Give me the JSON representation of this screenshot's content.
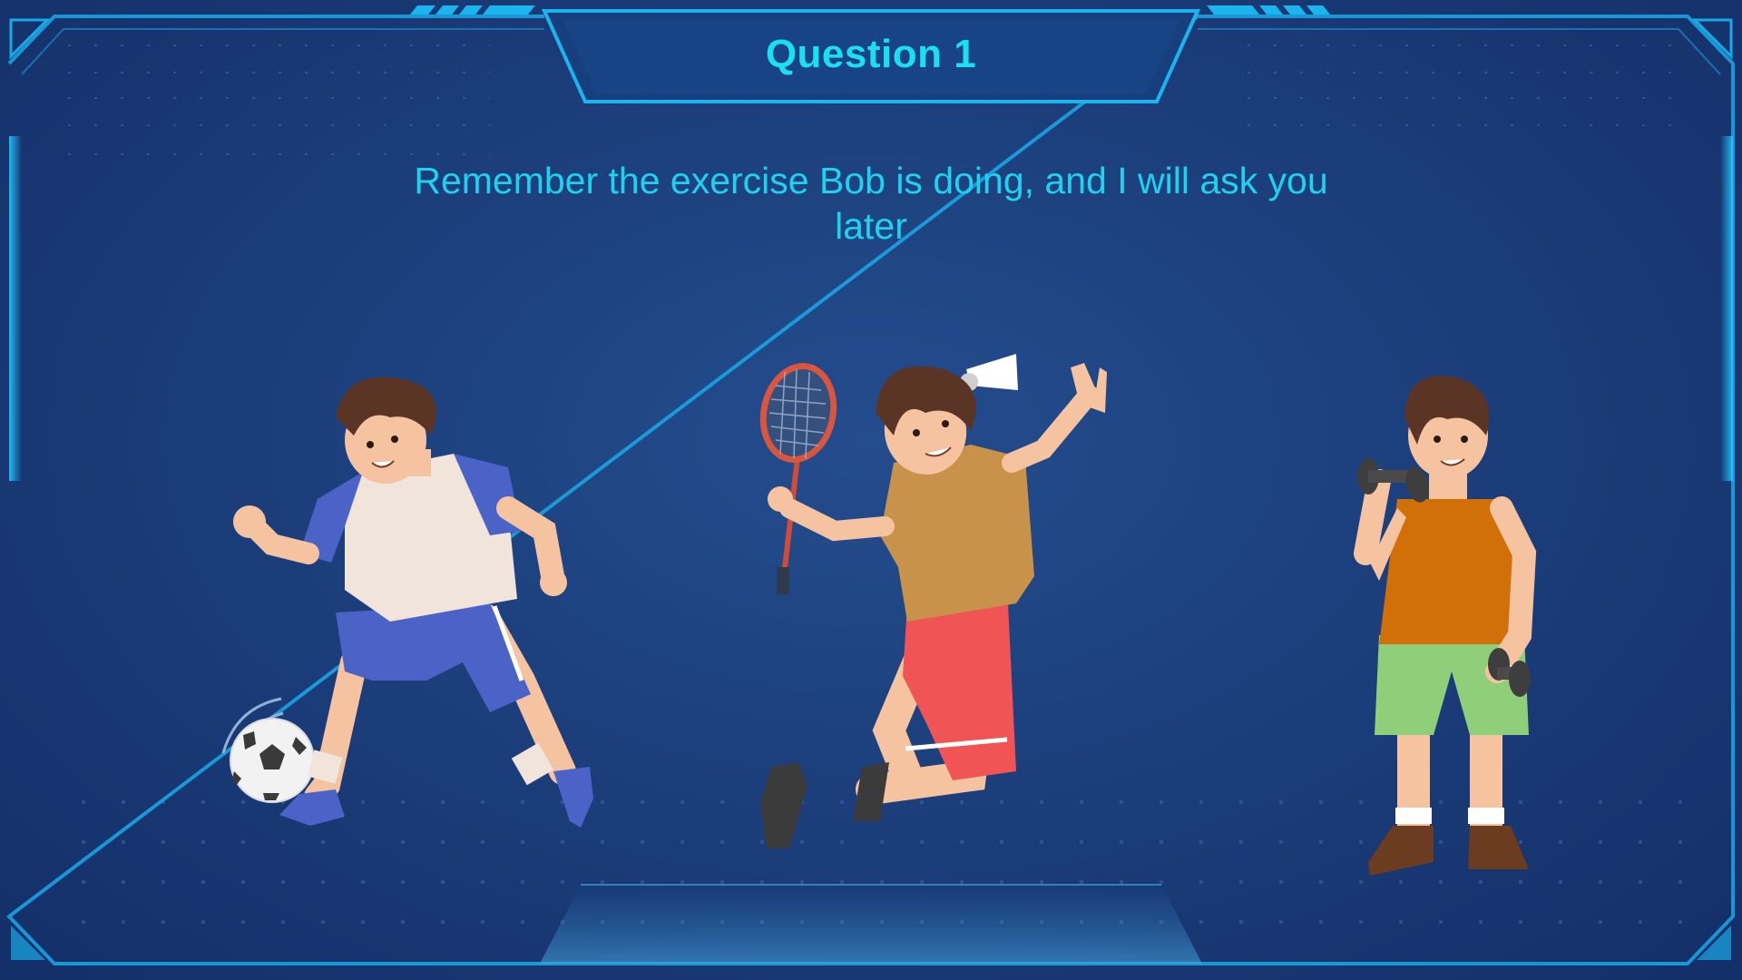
{
  "header": {
    "title": "Question 1"
  },
  "prompt": {
    "text": "Remember the exercise Bob is doing, and I will ask you later"
  },
  "figures": [
    {
      "activity": "soccer",
      "icon": "soccer-ball-icon"
    },
    {
      "activity": "badminton",
      "icon": "badminton-racket-icon"
    },
    {
      "activity": "weightlifting",
      "icon": "dumbbell-icon"
    }
  ],
  "colors": {
    "accent_cyan": "#18e0f2",
    "background": "#1c3f7c",
    "frame": "#1aa9e6"
  }
}
